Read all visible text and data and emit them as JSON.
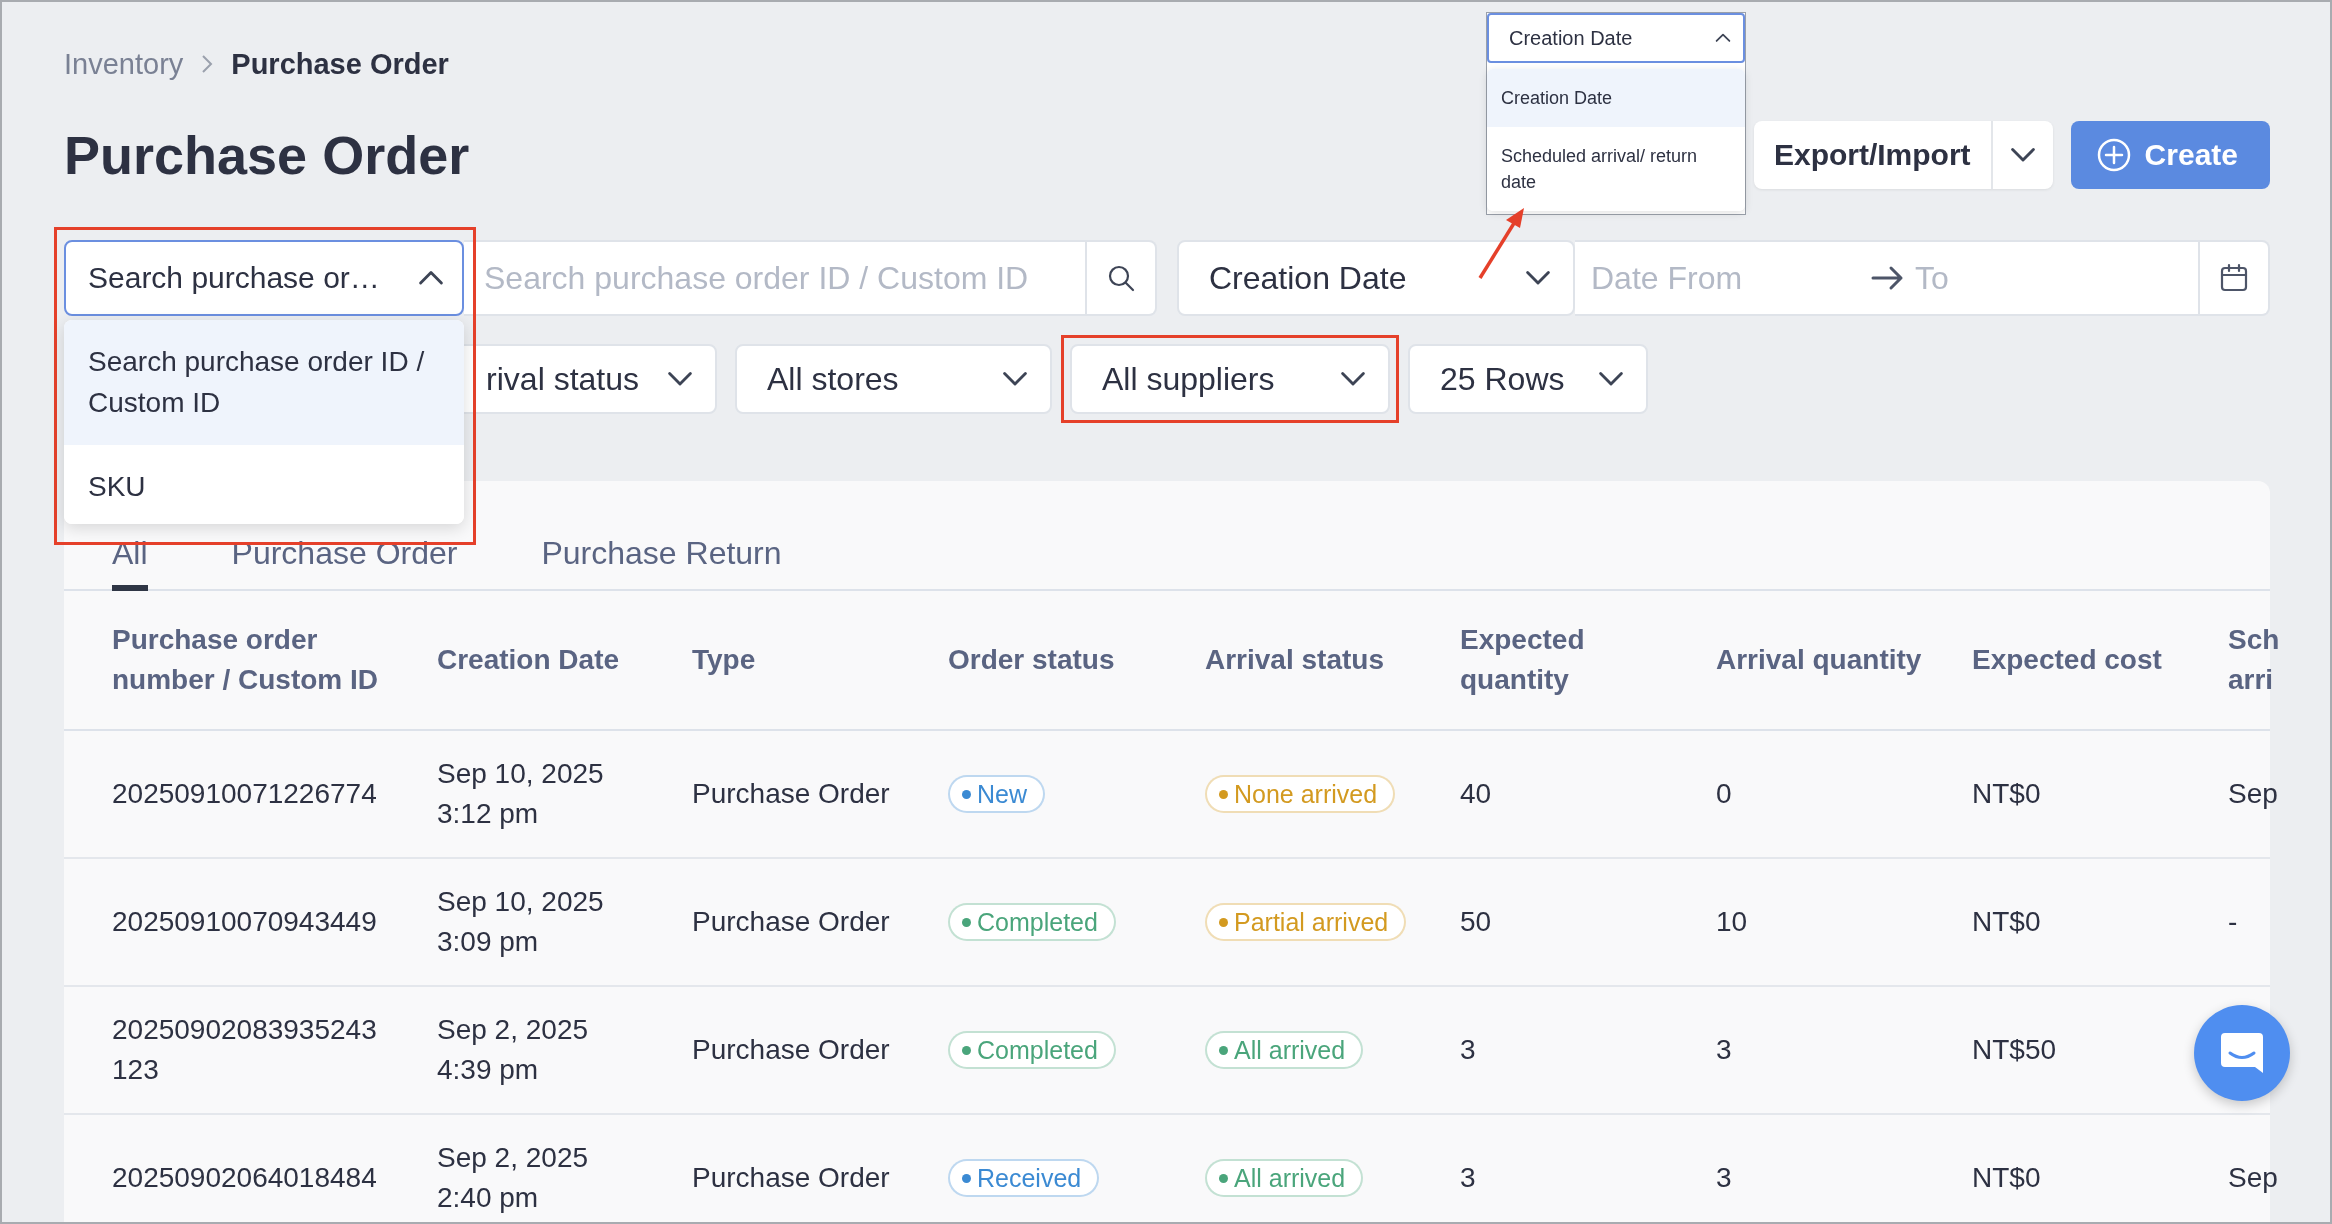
{
  "breadcrumb": [
    {
      "label": "Inventory",
      "current": false
    },
    {
      "label": "Purchase Order",
      "current": true
    }
  ],
  "title": "Purchase Order",
  "actions": {
    "export": "Export/Import",
    "create": "Create"
  },
  "search": {
    "type_value": "Search purchase or…",
    "highlighted": true,
    "expanded": true,
    "placeholder": "Search purchase order ID / Custom ID",
    "options": [
      {
        "label": "Search purchase order ID / Custom ID",
        "selected": true
      },
      {
        "label": "SKU",
        "selected": false
      }
    ]
  },
  "date": {
    "type_value": "Creation Date",
    "from_placeholder": "Date From",
    "to_placeholder": "To"
  },
  "date_type_callout": {
    "value": "Creation Date",
    "options": [
      {
        "label": "Creation Date",
        "selected": true
      },
      {
        "label": "Scheduled arrival/ return date",
        "selected": false
      }
    ]
  },
  "filters": [
    {
      "value": "rival status",
      "highlighted": false
    },
    {
      "value": "All stores",
      "highlighted": false
    },
    {
      "value": "All suppliers",
      "highlighted": true
    },
    {
      "value": "25 Rows",
      "highlighted": false
    }
  ],
  "tabs": [
    {
      "label": "All",
      "selected": true
    },
    {
      "label": "Purchase Order",
      "selected": false
    },
    {
      "label": "Purchase Return",
      "selected": false
    }
  ],
  "table": {
    "columns": [
      "Purchase order\nnumber / Custom ID",
      "Creation Date",
      "Type",
      "Order status",
      "Arrival status",
      "Expected\nquantity",
      "Arrival quantity",
      "Expected cost",
      "Sch\narri"
    ],
    "rows": [
      {
        "id": "20250910071226774",
        "date": "Sep 10, 2025\n3:12 pm",
        "type": "Purchase Order",
        "order_status": {
          "label": "New",
          "color": "#3b8ad3"
        },
        "arrival_status": {
          "label": "None arrived",
          "color": "#d39a20"
        },
        "expected_qty": "40",
        "arrival_qty": "0",
        "expected_cost": "NT$0",
        "scheduled": "Sep"
      },
      {
        "id": "20250910070943449",
        "date": "Sep 10, 2025\n3:09 pm",
        "type": "Purchase Order",
        "order_status": {
          "label": "Completed",
          "color": "#4aa57b"
        },
        "arrival_status": {
          "label": "Partial arrived",
          "color": "#d39a20"
        },
        "expected_qty": "50",
        "arrival_qty": "10",
        "expected_cost": "NT$0",
        "scheduled": "-"
      },
      {
        "id": "20250902083935243\n123",
        "date": "Sep 2, 2025\n4:39 pm",
        "type": "Purchase Order",
        "order_status": {
          "label": "Completed",
          "color": "#4aa57b"
        },
        "arrival_status": {
          "label": "All arrived",
          "color": "#4aa57b"
        },
        "expected_qty": "3",
        "arrival_qty": "3",
        "expected_cost": "NT$50"
      },
      {
        "id": "20250902064018484",
        "date": "Sep 2, 2025\n2:40 pm",
        "type": "Purchase Order",
        "order_status": {
          "label": "Received",
          "color": "#3b8ad3"
        },
        "arrival_status": {
          "label": "All arrived",
          "color": "#4aa57b"
        },
        "expected_qty": "3",
        "arrival_qty": "3",
        "expected_cost": "NT$0",
        "scheduled": "Sep"
      }
    ]
  }
}
